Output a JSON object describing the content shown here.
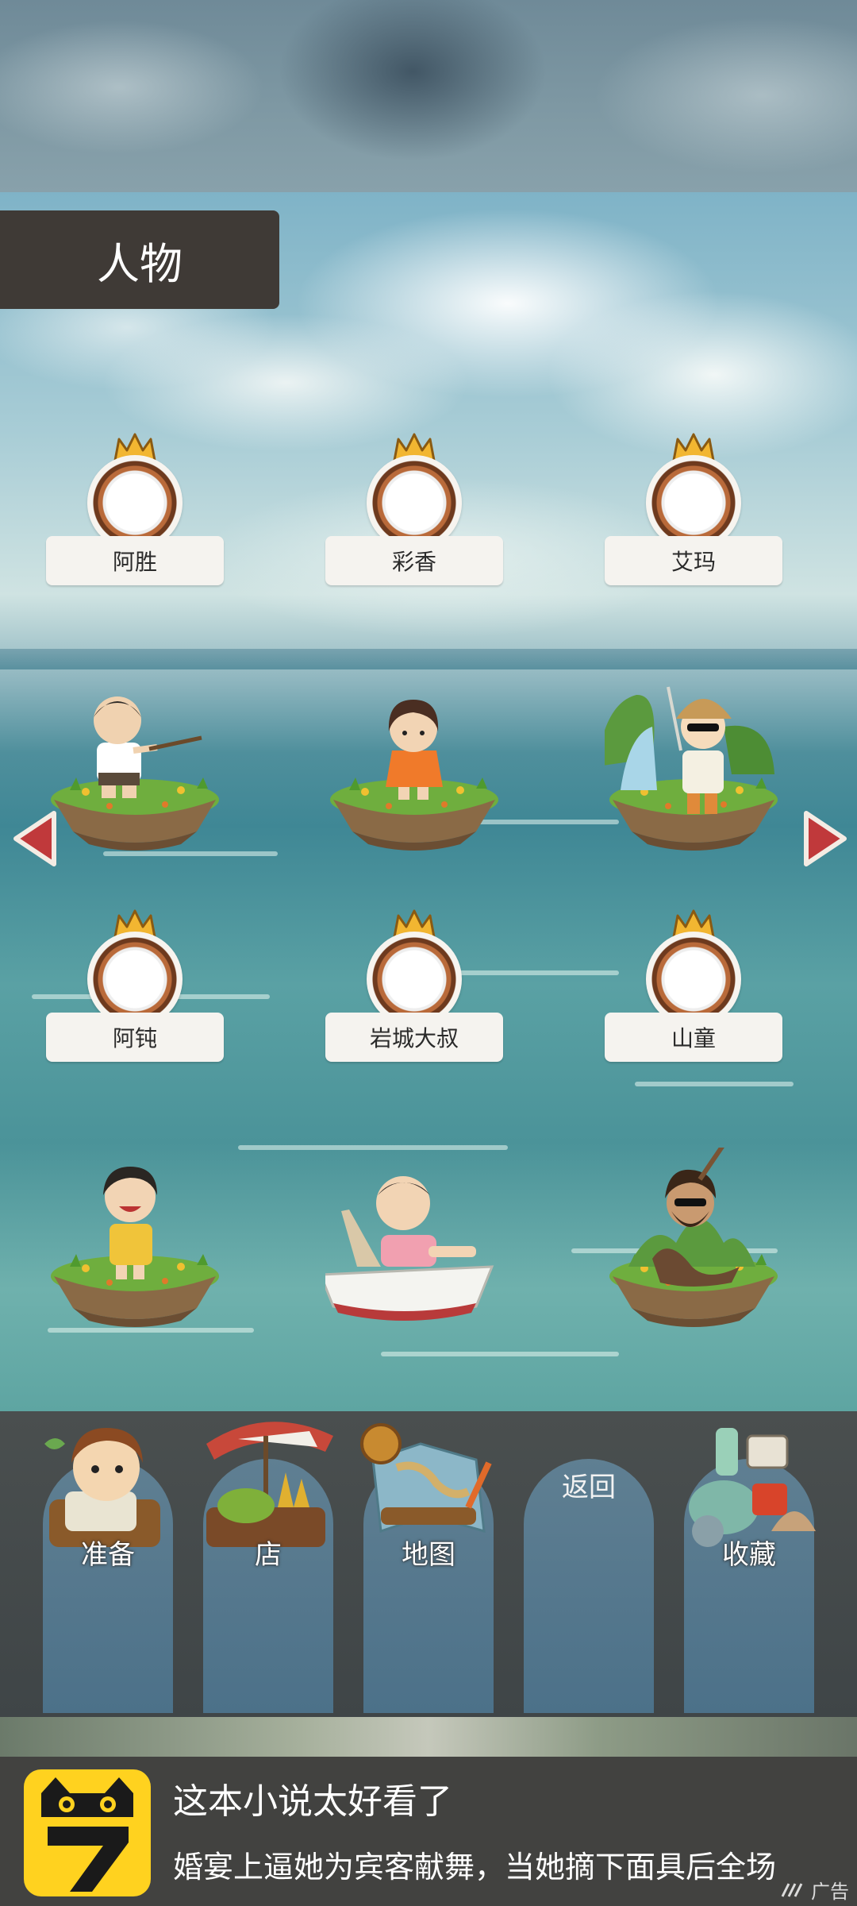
{
  "screen": {
    "title": "人物"
  },
  "characters": [
    {
      "name": "阿胜",
      "icon": "fisherman-boy-icon"
    },
    {
      "name": "彩香",
      "icon": "little-girl-icon"
    },
    {
      "name": "艾玛",
      "icon": "explorer-woman-icon"
    },
    {
      "name": "阿钝",
      "icon": "laughing-boy-icon"
    },
    {
      "name": "岩城大叔",
      "icon": "old-man-boat-icon"
    },
    {
      "name": "山童",
      "icon": "wild-man-icon"
    }
  ],
  "navigation": {
    "prev": "previous-page-arrow",
    "next": "next-page-arrow"
  },
  "menu": [
    {
      "label": "准备",
      "icon": "boy-backpack-icon"
    },
    {
      "label": "店",
      "icon": "market-stall-icon"
    },
    {
      "label": "地图",
      "icon": "map-compass-icon"
    },
    {
      "label": "返回",
      "icon": ""
    },
    {
      "label": "收藏",
      "icon": "treasure-pile-icon"
    }
  ],
  "ad": {
    "title": "这本小说太好看了",
    "description": "婚宴上逼她为宾客献舞，当她摘下面具后全场",
    "badge": "广告",
    "logo_text": "7"
  },
  "colors": {
    "tab_bg": "#3f3a36",
    "plate_bg": "#f5f3ef",
    "arrow": "#c0393b",
    "menu_column": "#5a7c90",
    "ad_bg": "#424240",
    "ad_logo": "#ffd21f"
  }
}
